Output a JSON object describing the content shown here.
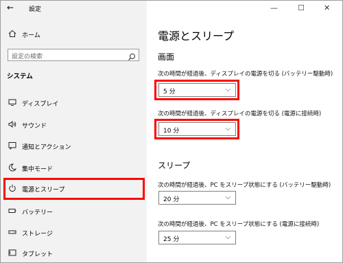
{
  "header": {
    "back_icon": "back-arrow-icon",
    "title": "設定"
  },
  "window_controls": {
    "minimize": "—",
    "maximize": "☐",
    "close": "✕"
  },
  "sidebar": {
    "home_label": "ホーム",
    "search_placeholder": "設定の検索",
    "section_title": "システム",
    "items": [
      {
        "label": "ディスプレイ",
        "icon": "display-icon"
      },
      {
        "label": "サウンド",
        "icon": "speaker-icon"
      },
      {
        "label": "通知とアクション",
        "icon": "notification-icon"
      },
      {
        "label": "集中モード",
        "icon": "moon-icon"
      },
      {
        "label": "電源とスリープ",
        "icon": "power-icon",
        "selected": true
      },
      {
        "label": "バッテリー",
        "icon": "battery-icon"
      },
      {
        "label": "ストレージ",
        "icon": "storage-icon"
      },
      {
        "label": "タブレット",
        "icon": "tablet-icon"
      }
    ]
  },
  "main": {
    "title": "電源とスリープ",
    "screen": {
      "title": "画面",
      "battery_label": "次の時間が経過後、ディスプレイの電源を切る (バッテリー駆動時)",
      "battery_value": "5 分",
      "plugged_label": "次の時間が経過後、ディスプレイの電源を切る (電源に接続時)",
      "plugged_value": "10 分"
    },
    "sleep": {
      "title": "スリープ",
      "battery_label": "次の時間が経過後、PC をスリープ状態にする (バッテリー駆動時)",
      "battery_value": "20 分",
      "plugged_label": "次の時間が経過後、PC をスリープ状態にする (電源に接続時)",
      "plugged_value": "25 分"
    }
  },
  "colors": {
    "highlight": "#ff0000",
    "sidebar_bg": "#f2f2f2"
  }
}
